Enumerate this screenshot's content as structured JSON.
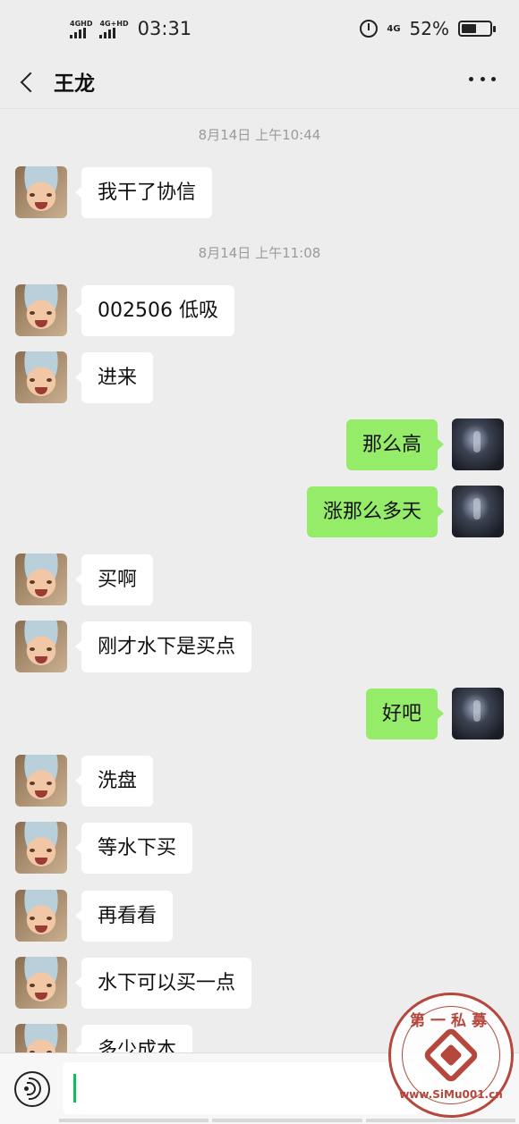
{
  "status_bar": {
    "signal_1": "4GHD",
    "signal_2": "4G+HD",
    "time": "03:31",
    "network": "4G",
    "battery": "52%",
    "battery_level": 0.52
  },
  "header": {
    "title": "王龙"
  },
  "timestamps": [
    "8月14日 上午10:44",
    "8月14日 上午11:08"
  ],
  "messages": [
    {
      "from": "other",
      "text": "我干了协信"
    },
    {
      "from": "other",
      "text": "002506 低吸"
    },
    {
      "from": "other",
      "text": "进来"
    },
    {
      "from": "me",
      "text": "那么高"
    },
    {
      "from": "me",
      "text": "涨那么多天"
    },
    {
      "from": "other",
      "text": "买啊"
    },
    {
      "from": "other",
      "text": "刚才水下是买点"
    },
    {
      "from": "me",
      "text": "好吧"
    },
    {
      "from": "other",
      "text": "洗盘"
    },
    {
      "from": "other",
      "text": "等水下买"
    },
    {
      "from": "other",
      "text": "再看看"
    },
    {
      "from": "other",
      "text": "水下可以买一点"
    },
    {
      "from": "other",
      "text": "多少成本"
    }
  ],
  "input": {
    "value": ""
  },
  "watermark": {
    "text": "第一私募",
    "url": "www.SiMu001.cn"
  },
  "icons": {
    "back": "chevron-left-icon",
    "more": "more-dots-icon",
    "voice": "voice-icon",
    "alarm": "alarm-icon",
    "battery": "battery-icon"
  }
}
